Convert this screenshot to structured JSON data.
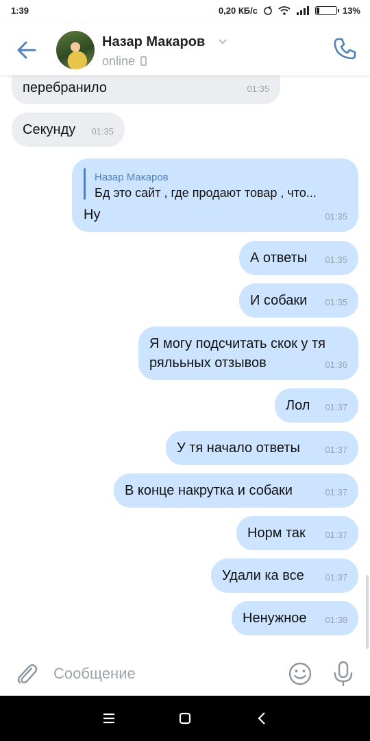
{
  "status_bar": {
    "time": "1:39",
    "speed": "0,20 КБ/с",
    "battery_percent": "13%",
    "battery_level": 0.13
  },
  "header": {
    "contact_name": "Назар Макаров",
    "status": "online"
  },
  "messages": [
    {
      "direction": "in",
      "text": "перебранило",
      "time": "01:35"
    },
    {
      "direction": "in",
      "text": "Секунду",
      "time": "01:35"
    },
    {
      "direction": "out",
      "reply_author": "Назар Макаров",
      "reply_text": "Бд это сайт , где продают товар , что...",
      "text": "Ну",
      "time": "01:35"
    },
    {
      "direction": "out",
      "text": "А ответы",
      "time": "01:35"
    },
    {
      "direction": "out",
      "text": "И собаки",
      "time": "01:35"
    },
    {
      "direction": "out",
      "text_line1": "Я могу подсчитать скок у тя",
      "text_line2": "рялььных отзывов",
      "time": "01:36"
    },
    {
      "direction": "out",
      "text": "Лол",
      "time": "01:37"
    },
    {
      "direction": "out",
      "text": "У тя начало ответы",
      "time": "01:37"
    },
    {
      "direction": "out",
      "text": "В конце накрутка и собаки",
      "time": "01:37"
    },
    {
      "direction": "out",
      "text": "Норм так",
      "time": "01:37"
    },
    {
      "direction": "out",
      "text": "Удали ка все",
      "time": "01:37"
    },
    {
      "direction": "out",
      "text": "Ненужное",
      "time": "01:38"
    }
  ],
  "composer": {
    "placeholder": "Сообщение"
  },
  "colors": {
    "accent": "#5181b8",
    "incoming_bubble": "#ebedf0",
    "outgoing_bubble": "#cce4ff"
  }
}
